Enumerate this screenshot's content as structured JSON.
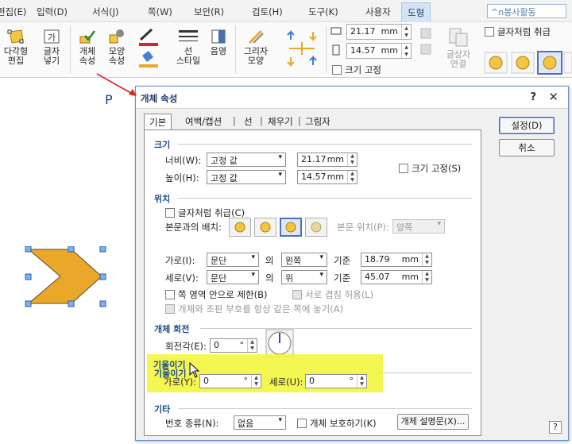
{
  "menu": {
    "items": [
      "편집(E)",
      "입력(D)",
      "서식(J)",
      "쪽(W)",
      "보안(R)",
      "검토(H)",
      "도구(K)",
      "사용자",
      "도형"
    ],
    "active": "도형",
    "search_placeholder": "^n봉사활동"
  },
  "ribbon": {
    "polygon_edit": "다각형\n편집",
    "text_insert": "글자\n넣기",
    "object_props": "개체\n속성",
    "shape_props": "모양\n속성",
    "line_style": "선\n스타일",
    "shading": "음영",
    "shape_look": "그리자\n모양",
    "width_value": "21.17",
    "height_value": "14.57",
    "unit": "mm",
    "fixed_size": "크기 고정",
    "treat_as_char": "글자처럼 취급",
    "textbox_link": "글상자\n연결"
  },
  "doc": {
    "letter": "P"
  },
  "dialog": {
    "title": "개체 속성",
    "help": "?",
    "close": "✕",
    "tabs": [
      "기본",
      "여백/캡션",
      "선",
      "채우기",
      "그림자"
    ],
    "ok": "설정(D)",
    "cancel": "취소",
    "size": {
      "section": "크기",
      "width_label": "너비(W):",
      "width_mode": "고정 값",
      "width_value": "21.17",
      "height_label": "높이(H):",
      "height_mode": "고정 값",
      "height_value": "14.57",
      "unit": "mm",
      "fixed": "크기 고정(S)"
    },
    "position": {
      "section": "위치",
      "treat_as_char": "글자처럼 취급(C)",
      "wrap_label": "본문과의 배치:",
      "body_pos_label": "본문 위치(P):",
      "body_pos_value": "양쪽",
      "h_label": "가로(I):",
      "h_base": "문단",
      "ui": "의",
      "h_align": "왼쪽",
      "gijun": "기준",
      "h_value": "18.79",
      "v_label": "세로(V):",
      "v_base": "문단",
      "v_align": "위",
      "v_value": "45.07",
      "limit_page": "쪽 영역 안으로 제한(B)",
      "allow_overlap": "서로 겹침 허용(L)",
      "same_page": "개체와 조판 부호를 항상 같은 쪽에 놓기(A)"
    },
    "rotation": {
      "section": "개체 회전",
      "angle_label": "회전각(E):",
      "angle_value": "0",
      "deg": "°"
    },
    "skew": {
      "section": "기울이기",
      "h_label": "가로(Y):",
      "h_value": "0",
      "v_label": "세로(U):",
      "v_value": "0",
      "deg": "°"
    },
    "other": {
      "section": "기타",
      "number_label": "번호 종류(N):",
      "number_value": "없음",
      "protect": "개체 보호하기(K)",
      "desc_button": "개체 설명문(X)..."
    }
  },
  "colors": {
    "highlight": "#f2f53a",
    "shape_fill": "#e9a82a",
    "accent": "#1a4a8a",
    "arrow": "#e02020"
  }
}
